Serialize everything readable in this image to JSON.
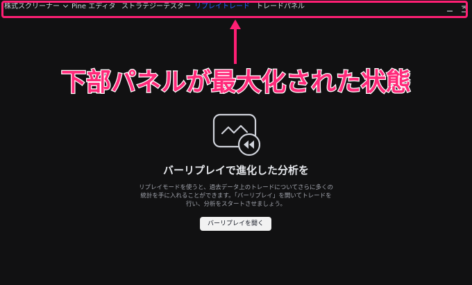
{
  "tabs": [
    {
      "label": "株式スクリーナー",
      "has_dropdown": true,
      "active": false
    },
    {
      "label": "Pine エディタ",
      "active": false
    },
    {
      "label": "ストラテジーテスター",
      "active": false
    },
    {
      "label": "リプレイトレード",
      "active": true
    },
    {
      "label": "トレードパネル",
      "active": false
    }
  ],
  "window_controls": [
    {
      "icon": "minimize-icon"
    },
    {
      "icon": "collapse-panel-icon"
    }
  ],
  "annotation": {
    "text": "下部パネルが最大化された状態",
    "color": "#ff2a7a",
    "outline_color": "#ffffff",
    "highlight_color": "#ff1f74"
  },
  "empty_state": {
    "icon": "replay-chart-icon",
    "title": "バーリプレイで進化した分析を",
    "description_lines": [
      "リプレイモードを使うと、過去データ上のトレードについてさらに多くの",
      "統計を手に入れることができます。「バーリプレイ」を開いてトレードを",
      "行い、分析をスタートさせましょう。"
    ],
    "button_label": "バーリプレイを開く"
  },
  "colors": {
    "background": "#111112",
    "active_tab": "#2962ff",
    "text": "#d1d4dc"
  }
}
